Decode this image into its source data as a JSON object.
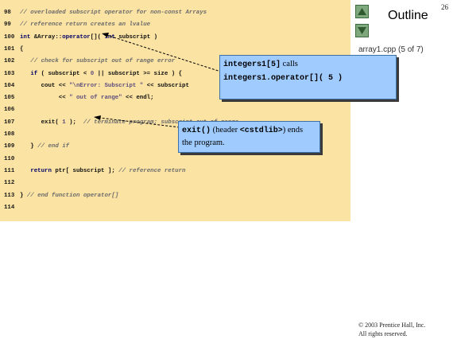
{
  "code_lines": [
    {
      "num": "98",
      "spans": [
        {
          "cls": "c-comment",
          "text": "// overloaded subscript operator for non-const Arrays"
        }
      ]
    },
    {
      "num": "99",
      "spans": [
        {
          "cls": "c-comment",
          "text": "// reference return creates an lvalue"
        }
      ]
    },
    {
      "num": "100",
      "spans": [
        {
          "cls": "c-kw",
          "text": "int"
        },
        {
          "cls": "c-plain",
          "text": " &Array::"
        },
        {
          "cls": "c-kw",
          "text": "operator"
        },
        {
          "cls": "c-plain",
          "text": "[]( "
        },
        {
          "cls": "c-kw",
          "text": "int"
        },
        {
          "cls": "c-plain",
          "text": " subscript )"
        }
      ]
    },
    {
      "num": "101",
      "spans": [
        {
          "cls": "c-plain",
          "text": "{"
        }
      ]
    },
    {
      "num": "102",
      "spans": [
        {
          "cls": "c-comment",
          "text": "   // check for subscript out of range error"
        }
      ]
    },
    {
      "num": "103",
      "spans": [
        {
          "cls": "c-plain",
          "text": "   "
        },
        {
          "cls": "c-kw",
          "text": "if"
        },
        {
          "cls": "c-plain",
          "text": " ( subscript < "
        },
        {
          "cls": "c-str",
          "text": "0"
        },
        {
          "cls": "c-plain",
          "text": " || subscript >= size ) {"
        }
      ]
    },
    {
      "num": "104",
      "spans": [
        {
          "cls": "c-plain",
          "text": "      cout << "
        },
        {
          "cls": "c-str",
          "text": "\"\\nError: Subscript \""
        },
        {
          "cls": "c-plain",
          "text": " << subscript"
        }
      ]
    },
    {
      "num": "105",
      "spans": [
        {
          "cls": "c-plain",
          "text": "           << "
        },
        {
          "cls": "c-str",
          "text": "\" out of range\""
        },
        {
          "cls": "c-plain",
          "text": " << endl;"
        }
      ]
    },
    {
      "num": "106",
      "spans": []
    },
    {
      "num": "107",
      "spans": [
        {
          "cls": "c-plain",
          "text": "      exit( "
        },
        {
          "cls": "c-str",
          "text": "1"
        },
        {
          "cls": "c-plain",
          "text": " );  "
        },
        {
          "cls": "c-comment",
          "text": "// terminate program; subscript out of range"
        }
      ]
    },
    {
      "num": "108",
      "spans": []
    },
    {
      "num": "109",
      "spans": [
        {
          "cls": "c-plain",
          "text": "   } "
        },
        {
          "cls": "c-comment",
          "text": "// end if"
        }
      ]
    },
    {
      "num": "110",
      "spans": []
    },
    {
      "num": "111",
      "spans": [
        {
          "cls": "c-plain",
          "text": "   "
        },
        {
          "cls": "c-kw",
          "text": "return"
        },
        {
          "cls": "c-plain",
          "text": " ptr[ subscript ]; "
        },
        {
          "cls": "c-comment",
          "text": "// reference return"
        }
      ]
    },
    {
      "num": "112",
      "spans": []
    },
    {
      "num": "113",
      "spans": [
        {
          "cls": "c-plain",
          "text": "} "
        },
        {
          "cls": "c-comment",
          "text": "// end function operator[]"
        }
      ]
    },
    {
      "num": "114",
      "spans": []
    }
  ],
  "callout_1": {
    "line1_code": "integers1[5]",
    "line1_text": " calls",
    "line2_code": "integers1.operator[]( 5 )"
  },
  "callout_2": {
    "line1_code": "exit()",
    "line1_text_a": " (header ",
    "line1_code_b": "<cstdlib>",
    "line1_text_c": ") ends",
    "line2_text": "the program."
  },
  "sidebar": {
    "slide_number": "26",
    "outline_title": "Outline",
    "file_label": "array1.cpp (5 of 7)",
    "nav_up_icon": "triangle-up-icon",
    "nav_down_icon": "triangle-down-icon"
  },
  "footer": {
    "copyright_line1": "© 2003 Prentice Hall, Inc.",
    "copyright_line2": "All rights reserved."
  }
}
